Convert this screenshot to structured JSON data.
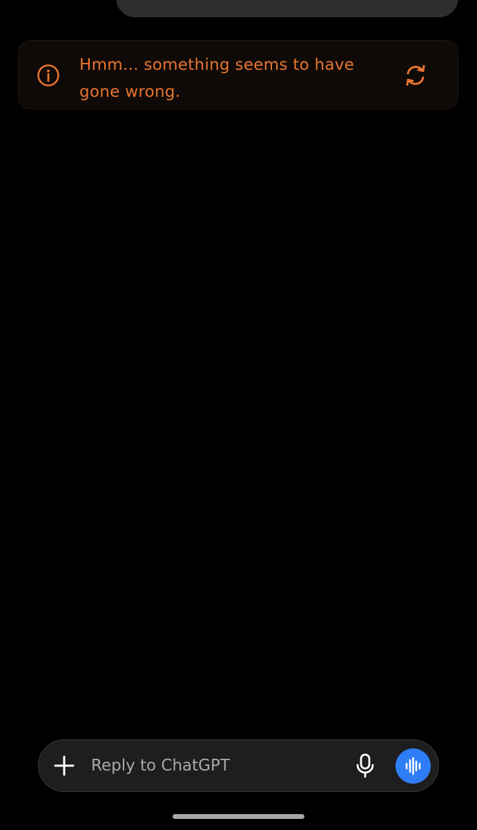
{
  "error_banner": {
    "message": "Hmm... something seems to have gone wrong.",
    "info_icon": "info-circle-icon",
    "retry_icon": "refresh-icon",
    "accent_color": "#e9742f"
  },
  "composer": {
    "placeholder": "Reply to ChatGPT",
    "value": "",
    "plus_icon": "plus-icon",
    "mic_icon": "microphone-icon",
    "voice_icon": "voice-waveform-icon",
    "voice_button_color": "#2f7df6"
  }
}
